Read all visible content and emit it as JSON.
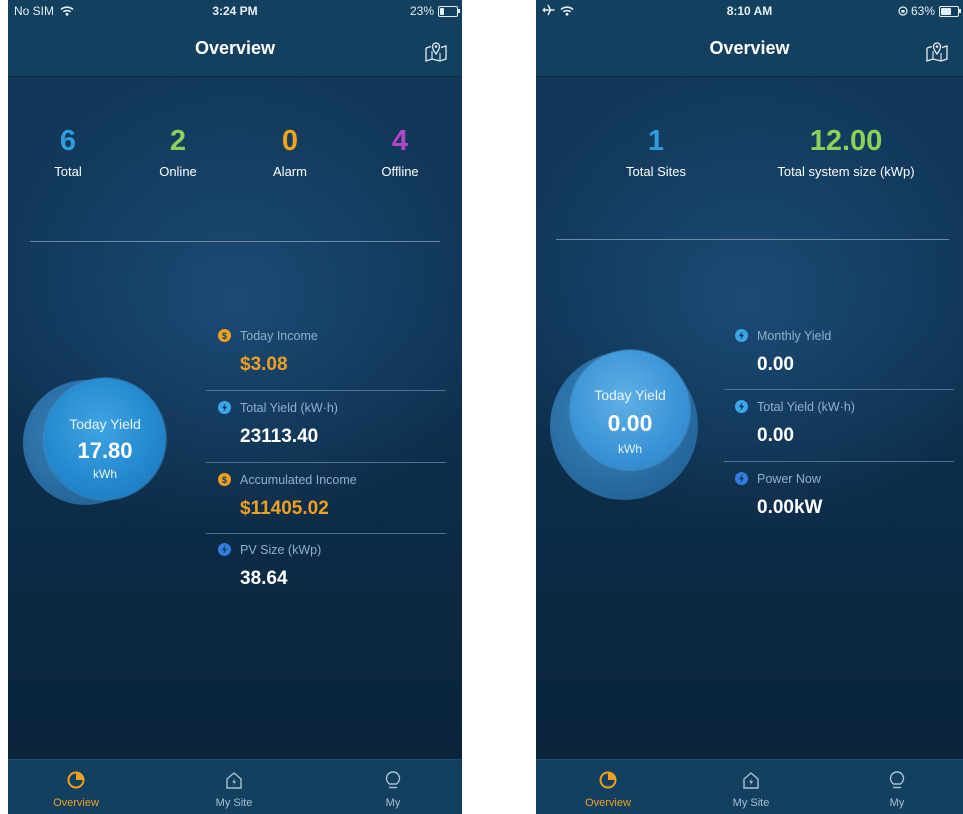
{
  "screens": [
    {
      "status": {
        "carrier": "No SIM",
        "time": "3:24 PM",
        "battery": "23%"
      },
      "nav": {
        "title": "Overview",
        "map_icon": "map-pin-icon"
      },
      "stats": [
        {
          "value": "6",
          "label": "Total",
          "color": "#2d9ce0"
        },
        {
          "value": "2",
          "label": "Online",
          "color": "#8fd05a"
        },
        {
          "value": "0",
          "label": "Alarm",
          "color": "#f4a51c"
        },
        {
          "value": "4",
          "label": "Offline",
          "color": "#b046c8"
        }
      ],
      "yield": {
        "label": "Today Yield",
        "value": "17.80",
        "unit": "kWh"
      },
      "metrics": [
        {
          "label": "Today Income",
          "value": "$3.08",
          "icon": "dollar-icon",
          "value_color": "#f0a020"
        },
        {
          "label": "Total Yield (kW·h)",
          "value": "23113.40",
          "icon": "bolt-icon",
          "value_color": "#ffffff"
        },
        {
          "label": "Accumulated Income",
          "value": "$11405.02",
          "icon": "dollar-icon",
          "value_color": "#f0a020"
        },
        {
          "label": "PV Size (kWp)",
          "value": "38.64",
          "icon": "bolt-icon",
          "value_color": "#ffffff"
        }
      ],
      "tabs": [
        {
          "label": "Overview",
          "icon": "pie-chart-icon",
          "active": true
        },
        {
          "label": "My Site",
          "icon": "home-icon",
          "active": false
        },
        {
          "label": "My",
          "icon": "bulb-icon",
          "active": false
        }
      ]
    },
    {
      "status": {
        "carrier": "",
        "time": "8:10 AM",
        "battery": "63%"
      },
      "nav": {
        "title": "Overview",
        "map_icon": "map-pin-icon"
      },
      "stats": [
        {
          "value": "1",
          "label": "Total Sites",
          "color": "#2d9ce0"
        },
        {
          "value": "12.00",
          "label": "Total system size (kWp)",
          "color": "#8fd05a"
        }
      ],
      "yield": {
        "label": "Today Yield",
        "value": "0.00",
        "unit": "kWh"
      },
      "metrics": [
        {
          "label": "Monthly Yield",
          "value": "0.00",
          "icon": "bolt-icon",
          "value_color": "#ffffff"
        },
        {
          "label": "Total Yield (kW·h)",
          "value": "0.00",
          "icon": "bolt-icon",
          "value_color": "#ffffff"
        },
        {
          "label": "Power Now",
          "value": "0.00kW",
          "icon": "bolt-icon",
          "value_color": "#ffffff"
        }
      ],
      "tabs": [
        {
          "label": "Overview",
          "icon": "pie-chart-icon",
          "active": true
        },
        {
          "label": "My Site",
          "icon": "home-icon",
          "active": false
        },
        {
          "label": "My",
          "icon": "bulb-icon",
          "active": false
        }
      ]
    }
  ]
}
